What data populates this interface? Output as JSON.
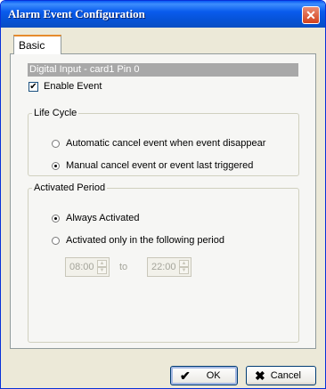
{
  "window": {
    "title": "Alarm Event Configuration",
    "close_glyph": "✕"
  },
  "tabs": [
    {
      "label": "Basic",
      "selected": true
    }
  ],
  "header": {
    "text": "Digital Input - card1 Pin 0"
  },
  "enable_event": {
    "label": "Enable Event",
    "checked": true,
    "check_glyph": "✔"
  },
  "life_cycle": {
    "legend": "Life Cycle",
    "options": [
      {
        "label": "Automatic cancel event when event disappear",
        "selected": false
      },
      {
        "label": "Manual cancel event or event last triggered",
        "selected": true
      }
    ]
  },
  "activated_period": {
    "legend": "Activated Period",
    "options": [
      {
        "label": "Always Activated",
        "selected": true
      },
      {
        "label": "Activated only in the following period",
        "selected": false
      }
    ],
    "start_time": "08:00",
    "to_label": "to",
    "end_time": "22:00"
  },
  "buttons": {
    "ok": {
      "label": "OK",
      "icon": "check-icon",
      "glyph": "✔"
    },
    "cancel": {
      "label": "Cancel",
      "icon": "cross-icon",
      "glyph": "✖"
    }
  }
}
